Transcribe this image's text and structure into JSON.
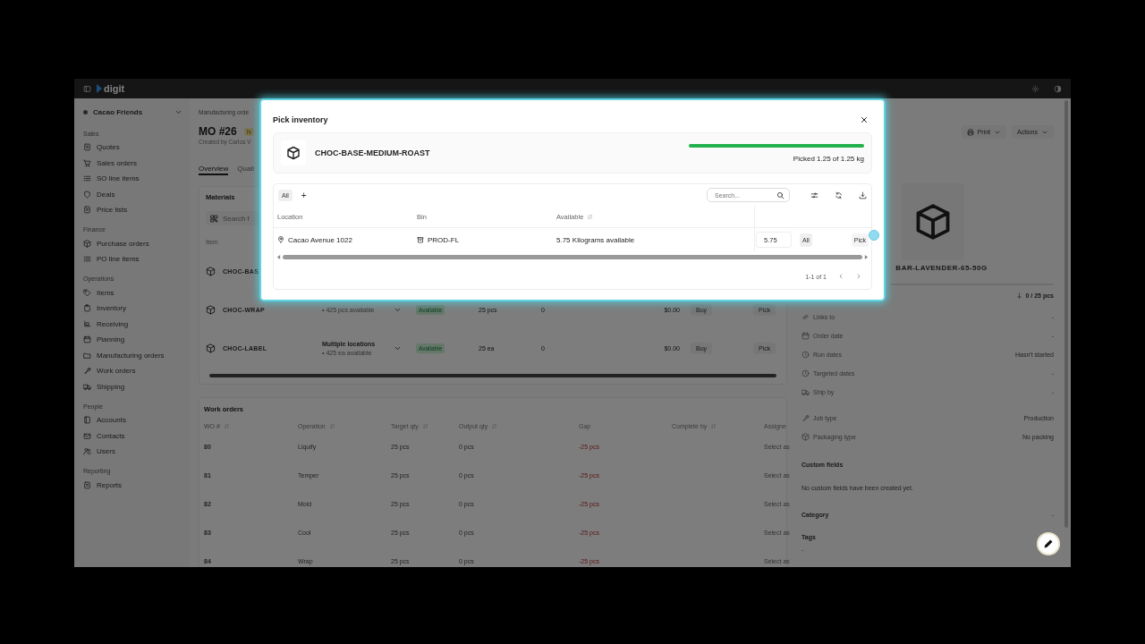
{
  "topbar": {
    "logo": "digit"
  },
  "sidebar": {
    "workspace": "Cacao Friends",
    "sections": [
      {
        "label": "Sales",
        "items": [
          {
            "label": "Quotes"
          },
          {
            "label": "Sales orders"
          },
          {
            "label": "SO line items"
          },
          {
            "label": "Deals"
          },
          {
            "label": "Price lists"
          }
        ]
      },
      {
        "label": "Finance",
        "items": [
          {
            "label": "Purchase orders"
          },
          {
            "label": "PO line items"
          }
        ]
      },
      {
        "label": "Operations",
        "items": [
          {
            "label": "Items"
          },
          {
            "label": "Inventory"
          },
          {
            "label": "Receiving"
          },
          {
            "label": "Planning"
          },
          {
            "label": "Manufacturing orders"
          },
          {
            "label": "Work orders"
          },
          {
            "label": "Shipping"
          }
        ]
      },
      {
        "label": "People",
        "items": [
          {
            "label": "Accounts"
          },
          {
            "label": "Contacts"
          },
          {
            "label": "Users"
          }
        ]
      },
      {
        "label": "Reporting",
        "items": [
          {
            "label": "Reports"
          }
        ]
      }
    ]
  },
  "main": {
    "breadcrumb": "Manufacturing orde",
    "title": "MO #26",
    "status_badge": "N",
    "created_by": "Created by Carlos V",
    "tabs": [
      {
        "label": "Overview",
        "selected": true
      },
      {
        "label": "Quali",
        "selected": false
      }
    ],
    "materials": {
      "title": "Materials",
      "search_placeholder": "Search f",
      "columns": [
        "Item"
      ],
      "rows": [
        {
          "item": "CHOC-BAS"
        },
        {
          "item": "CHOC-WRAP",
          "stock": "• 425 pcs available",
          "status": "Available",
          "required": "25 pcs",
          "picked": "0",
          "cost": "$0.00",
          "buy": "Buy",
          "pick": "Pick"
        },
        {
          "item": "CHOC-LABEL",
          "location": "Multiple locations",
          "stock": "• 425 ea available",
          "status": "Available",
          "required": "25 ea",
          "picked": "0",
          "cost": "$0.00",
          "buy": "Buy",
          "pick": "Pick"
        }
      ]
    },
    "work_orders": {
      "title": "Work orders",
      "columns": [
        {
          "label": "WO #",
          "sortable": true
        },
        {
          "label": "Operation",
          "sortable": true
        },
        {
          "label": "Target qty",
          "sortable": true
        },
        {
          "label": "Output qty",
          "sortable": true
        },
        {
          "label": "Gap",
          "sortable": false
        },
        {
          "label": "Complete by",
          "sortable": true
        },
        {
          "label": "Assigne",
          "sortable": false
        }
      ],
      "rows": [
        {
          "wo": "80",
          "operation": "Liquify",
          "target": "25 pcs",
          "output": "0 pcs",
          "gap": "-25 pcs",
          "assignee": "Select as"
        },
        {
          "wo": "81",
          "operation": "Temper",
          "target": "25 pcs",
          "output": "0 pcs",
          "gap": "-25 pcs",
          "assignee": "Select as"
        },
        {
          "wo": "82",
          "operation": "Mold",
          "target": "25 pcs",
          "output": "0 pcs",
          "gap": "-25 pcs",
          "assignee": "Select as"
        },
        {
          "wo": "83",
          "operation": "Cool",
          "target": "25 pcs",
          "output": "0 pcs",
          "gap": "-25 pcs",
          "assignee": "Select as"
        },
        {
          "wo": "84",
          "operation": "Wrap",
          "target": "25 pcs",
          "output": "0 pcs",
          "gap": "-25 pcs",
          "assignee": "Select as"
        }
      ]
    }
  },
  "details": {
    "print": "Print",
    "actions": "Actions",
    "product": "BAR-LAVENDER-65-50G",
    "progress": "0 / 25 pcs",
    "field_groups": [
      [
        {
          "label": "Links to",
          "value": "-"
        },
        {
          "label": "Order date",
          "value": "-"
        },
        {
          "label": "Run dates",
          "value": "Hasn't started"
        },
        {
          "label": "Targeted dates",
          "value": "-"
        },
        {
          "label": "Ship by",
          "value": "-"
        }
      ],
      [
        {
          "label": "Job type",
          "value": "Production"
        },
        {
          "label": "Packaging type",
          "value": "No packing"
        }
      ]
    ],
    "custom_fields": {
      "title": "Custom fields",
      "empty": "No custom fields have been created yet."
    },
    "category": {
      "title": "Category",
      "value": "-"
    },
    "tags": {
      "title": "Tags",
      "value": "-"
    }
  },
  "modal": {
    "title": "Pick inventory",
    "product": "CHOC-BASE-MEDIUM-ROAST",
    "level": 1,
    "picked": "Picked 1.25 of 1.25 kg",
    "filters": [
      {
        "label": "All",
        "selected": true
      }
    ],
    "add": "+",
    "search_placeholder": "Search...",
    "columns": [
      {
        "label": "Location",
        "sortable": false
      },
      {
        "label": "Bin",
        "sortable": false
      },
      {
        "label": "Available",
        "sortable": true
      }
    ],
    "rows": [
      {
        "location": "Cacao Avenue 1022",
        "bin": "PROD-FL",
        "available": "5.75 Kilograms available",
        "quantity": "5.75",
        "all": "All",
        "pick": "Pick"
      }
    ],
    "pagination": "1-1 of 1"
  }
}
